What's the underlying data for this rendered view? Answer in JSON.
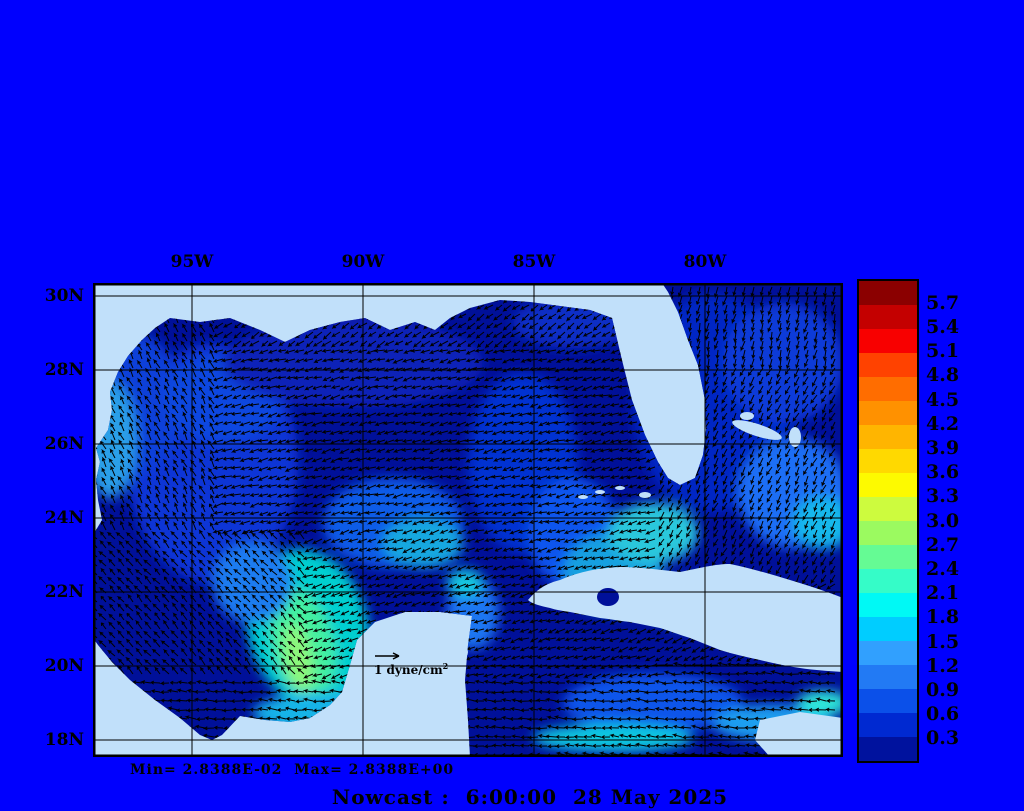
{
  "page": {
    "background_color": "#0000fe"
  },
  "title": "Nowcast :  6:00:00  28 May 2025",
  "stats_line": "Min= 2.8388E-02  Max= 2.8388E+00",
  "reference_vector": {
    "label": "1 dyne/cm",
    "exponent": "2"
  },
  "chart_data": {
    "type": "heatmap",
    "subtype": "vector_field_map",
    "region": "Gulf of Mexico",
    "title": "Nowcast :  6:00:00  28 May 2025",
    "units": "dyne/cm2",
    "x_axis": {
      "tick_labels": [
        "95W",
        "90W",
        "85W",
        "80W"
      ],
      "position": "top"
    },
    "y_axis": {
      "tick_labels": [
        "30N",
        "28N",
        "26N",
        "24N",
        "22N",
        "20N",
        "18N"
      ],
      "position": "left"
    },
    "grid": true,
    "data_min_label": "Min= 2.8388E-02",
    "data_max_label": "Max= 2.8388E+00",
    "data_min": 0.028388,
    "data_max": 2.8388,
    "colorbar": {
      "position": "right",
      "tick_labels": [
        "5.7",
        "5.4",
        "5.1",
        "4.8",
        "4.5",
        "4.2",
        "3.9",
        "3.6",
        "3.3",
        "3.0",
        "2.7",
        "2.4",
        "2.1",
        "1.8",
        "1.5",
        "1.2",
        "0.9",
        "0.6",
        "0.3"
      ],
      "segment_colors_top_to_bottom": [
        "#8b0000",
        "#c40000",
        "#f80000",
        "#ff4200",
        "#ff6d00",
        "#ff9100",
        "#ffb500",
        "#ffd900",
        "#fdfa00",
        "#cdfb3e",
        "#9bfa60",
        "#65fb94",
        "#35fcc8",
        "#00f9f5",
        "#00cdff",
        "#31a0fe",
        "#227af4",
        "#0b50e9",
        "#0029d1",
        "#00129e"
      ]
    },
    "colors": {
      "land": "#c1e0fa",
      "ocean_base": "#001099",
      "arrows": "#000000",
      "gridlines": "#000000",
      "frame": "#000000"
    },
    "vectors": {
      "reference_label": "1 dyne/cm2",
      "appearance": "dense small black wind-stress arrows over all water, pointing generally west to southwest"
    }
  }
}
